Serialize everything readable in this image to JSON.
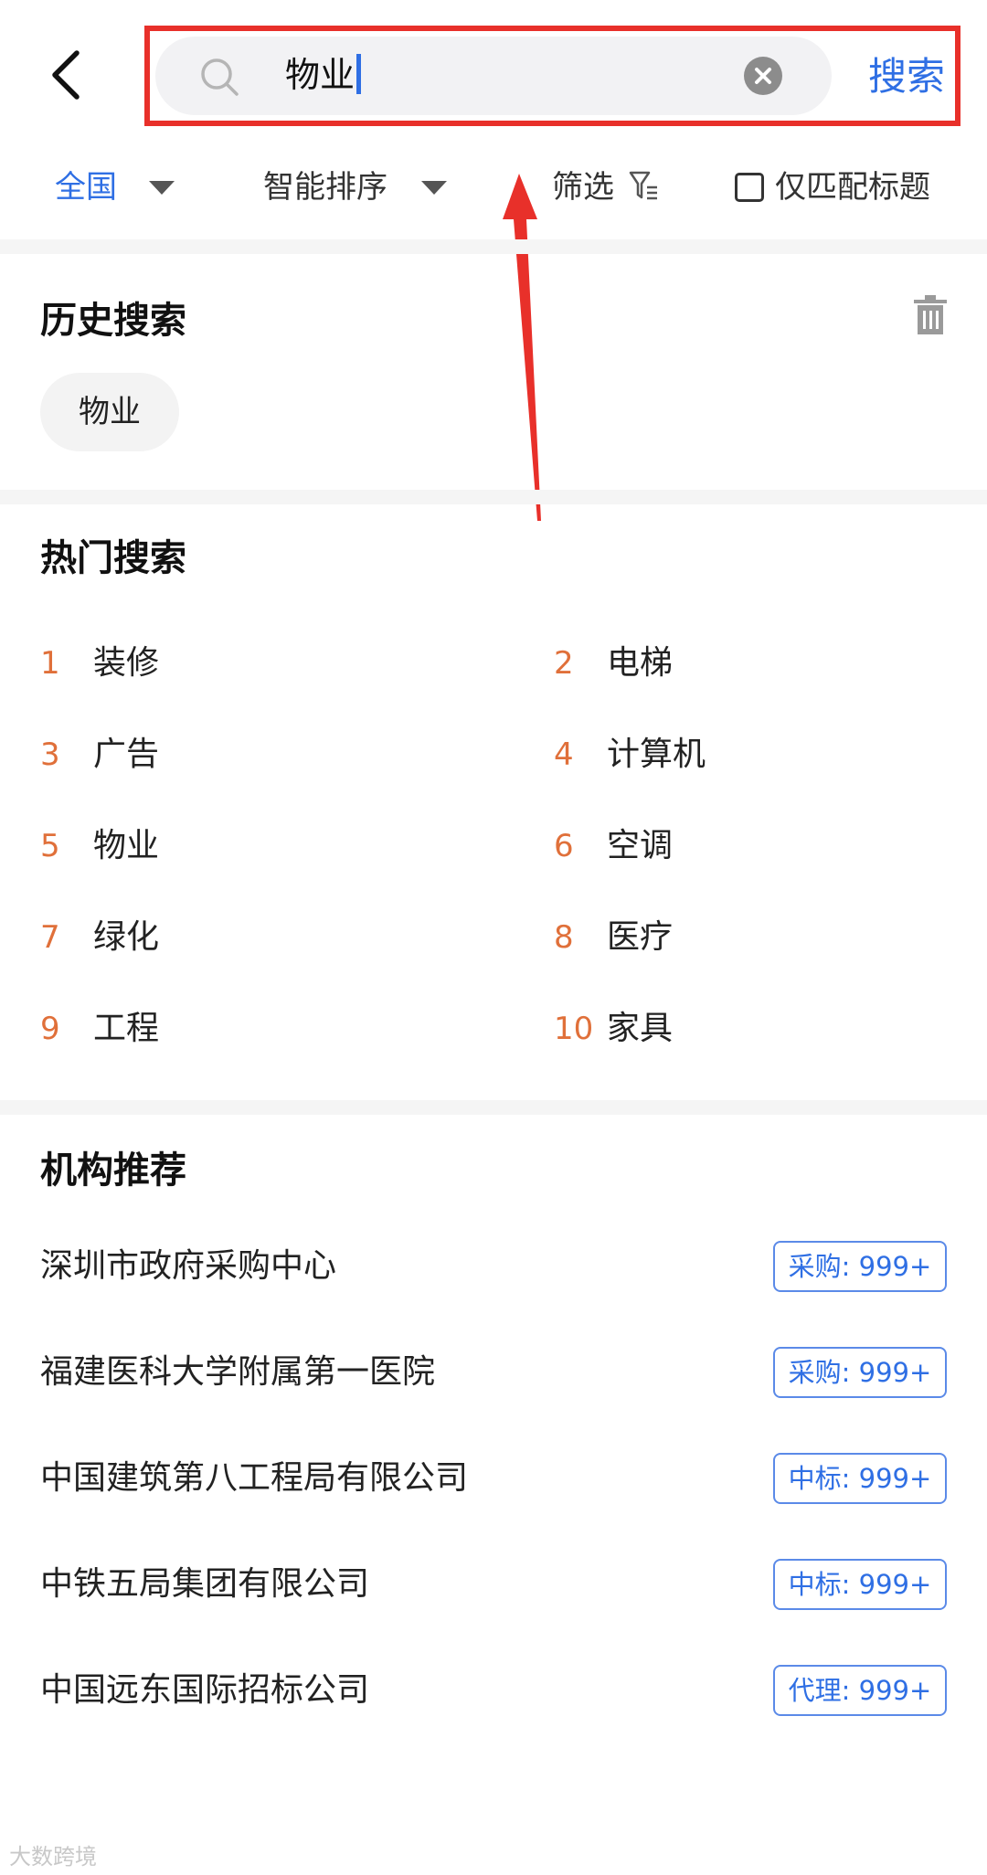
{
  "header": {
    "search_value": "物业",
    "search_button": "搜索"
  },
  "filters": {
    "region": "全国",
    "sort": "智能排序",
    "filter": "筛选",
    "title_only": "仅匹配标题"
  },
  "history": {
    "title": "历史搜索",
    "items": [
      "物业"
    ]
  },
  "hot": {
    "title": "热门搜索",
    "items": [
      {
        "rank": "1",
        "label": "装修"
      },
      {
        "rank": "2",
        "label": "电梯"
      },
      {
        "rank": "3",
        "label": "广告"
      },
      {
        "rank": "4",
        "label": "计算机"
      },
      {
        "rank": "5",
        "label": "物业"
      },
      {
        "rank": "6",
        "label": "空调"
      },
      {
        "rank": "7",
        "label": "绿化"
      },
      {
        "rank": "8",
        "label": "医疗"
      },
      {
        "rank": "9",
        "label": "工程"
      },
      {
        "rank": "10",
        "label": "家具"
      }
    ]
  },
  "orgs": {
    "title": "机构推荐",
    "items": [
      {
        "name": "深圳市政府采购中心",
        "tag": "采购: 999+"
      },
      {
        "name": "福建医科大学附属第一医院",
        "tag": "采购: 999+"
      },
      {
        "name": "中国建筑第八工程局有限公司",
        "tag": "中标: 999+"
      },
      {
        "name": "中铁五局集团有限公司",
        "tag": "中标: 999+"
      },
      {
        "name": "中国远东国际招标公司",
        "tag": "代理: 999+"
      }
    ]
  },
  "watermark": "大数跨境",
  "colors": {
    "accent": "#2f6fe4",
    "rank": "#e0703a",
    "annotation": "#e8302a"
  }
}
